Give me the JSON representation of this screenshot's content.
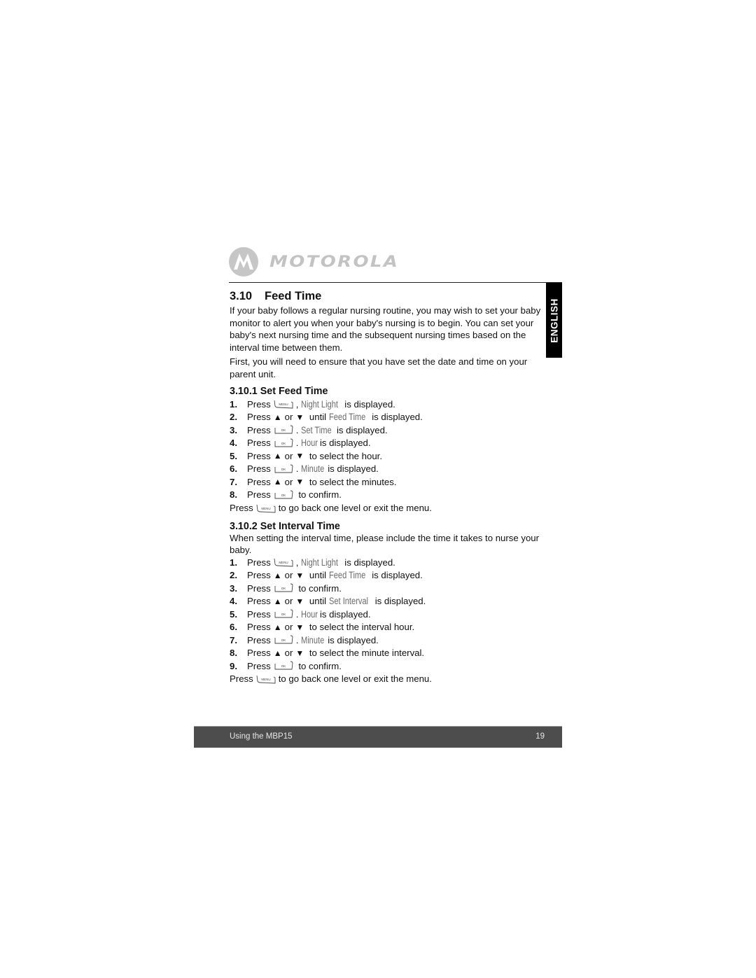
{
  "header": {
    "logo_icon": "motorola-batwing-logo",
    "brand": "MOTOROLA"
  },
  "language_tab": "ENGLISH",
  "section": {
    "number": "3.10",
    "title": "Feed Time",
    "intro": "If your baby follows a regular nursing routine, you may wish to set your baby monitor to alert you when your baby's nursing is to begin. You can set your baby's next  nursing time and the subsequent nursing times based on the interval time between them.",
    "note": "First, you will need to ensure that you have set the date and time on your parent unit."
  },
  "icons": {
    "menu_key": "menu-key-icon",
    "ok_key": "ok-key-icon",
    "up": "▲",
    "down": "▼"
  },
  "words": {
    "press": "Press",
    "or": "or"
  },
  "set_feed_time": {
    "heading": "3.10.1 Set Feed Time",
    "steps": [
      {
        "n": "1.",
        "key": "menu",
        "sep": ", ",
        "lcd": "Night Light",
        "after": " is displayed."
      },
      {
        "n": "2.",
        "arrows": true,
        "pre": " until ",
        "lcd": "Feed Time",
        "after": " is displayed."
      },
      {
        "n": "3.",
        "key": "ok",
        "sep": ". ",
        "lcd": "Set Time",
        "after": " is displayed."
      },
      {
        "n": "4.",
        "key": "ok",
        "sep": ". ",
        "lcd": "Hour",
        "after": " is displayed."
      },
      {
        "n": "5.",
        "arrows": true,
        "after": " to select the hour."
      },
      {
        "n": "6.",
        "key": "ok",
        "sep": ". ",
        "lcd": "Minute",
        "after": " is displayed."
      },
      {
        "n": "7.",
        "arrows": true,
        "after": " to select the minutes."
      },
      {
        "n": "8.",
        "key": "ok",
        "after": " to confirm."
      }
    ],
    "back_text": "to go back one level or exit the menu."
  },
  "set_interval_time": {
    "heading": "3.10.2 Set Interval Time",
    "intro": "When setting the interval time, please include the time it takes to nurse your baby.",
    "steps": [
      {
        "n": "1.",
        "key": "menu",
        "sep": ", ",
        "lcd": "Night Light",
        "after": " is displayed."
      },
      {
        "n": "2.",
        "arrows": true,
        "pre": " until ",
        "lcd": "Feed Time",
        "after": " is displayed."
      },
      {
        "n": "3.",
        "key": "ok",
        "after": " to confirm."
      },
      {
        "n": "4.",
        "arrows": true,
        "pre": " until ",
        "lcd": "Set Interval",
        "after": " is displayed."
      },
      {
        "n": "5.",
        "key": "ok",
        "sep": ". ",
        "lcd": "Hour",
        "after": " is displayed."
      },
      {
        "n": "6.",
        "arrows": true,
        "after": " to select the interval hour."
      },
      {
        "n": "7.",
        "key": "ok",
        "sep": ". ",
        "lcd": "Minute",
        "after": " is displayed."
      },
      {
        "n": "8.",
        "arrows": true,
        "after": " to select the minute interval."
      },
      {
        "n": "9.",
        "key": "ok",
        "after": " to confirm."
      }
    ],
    "back_text": "to go back one level or exit the menu."
  },
  "footer": {
    "title": "Using the MBP15",
    "page": "19"
  }
}
